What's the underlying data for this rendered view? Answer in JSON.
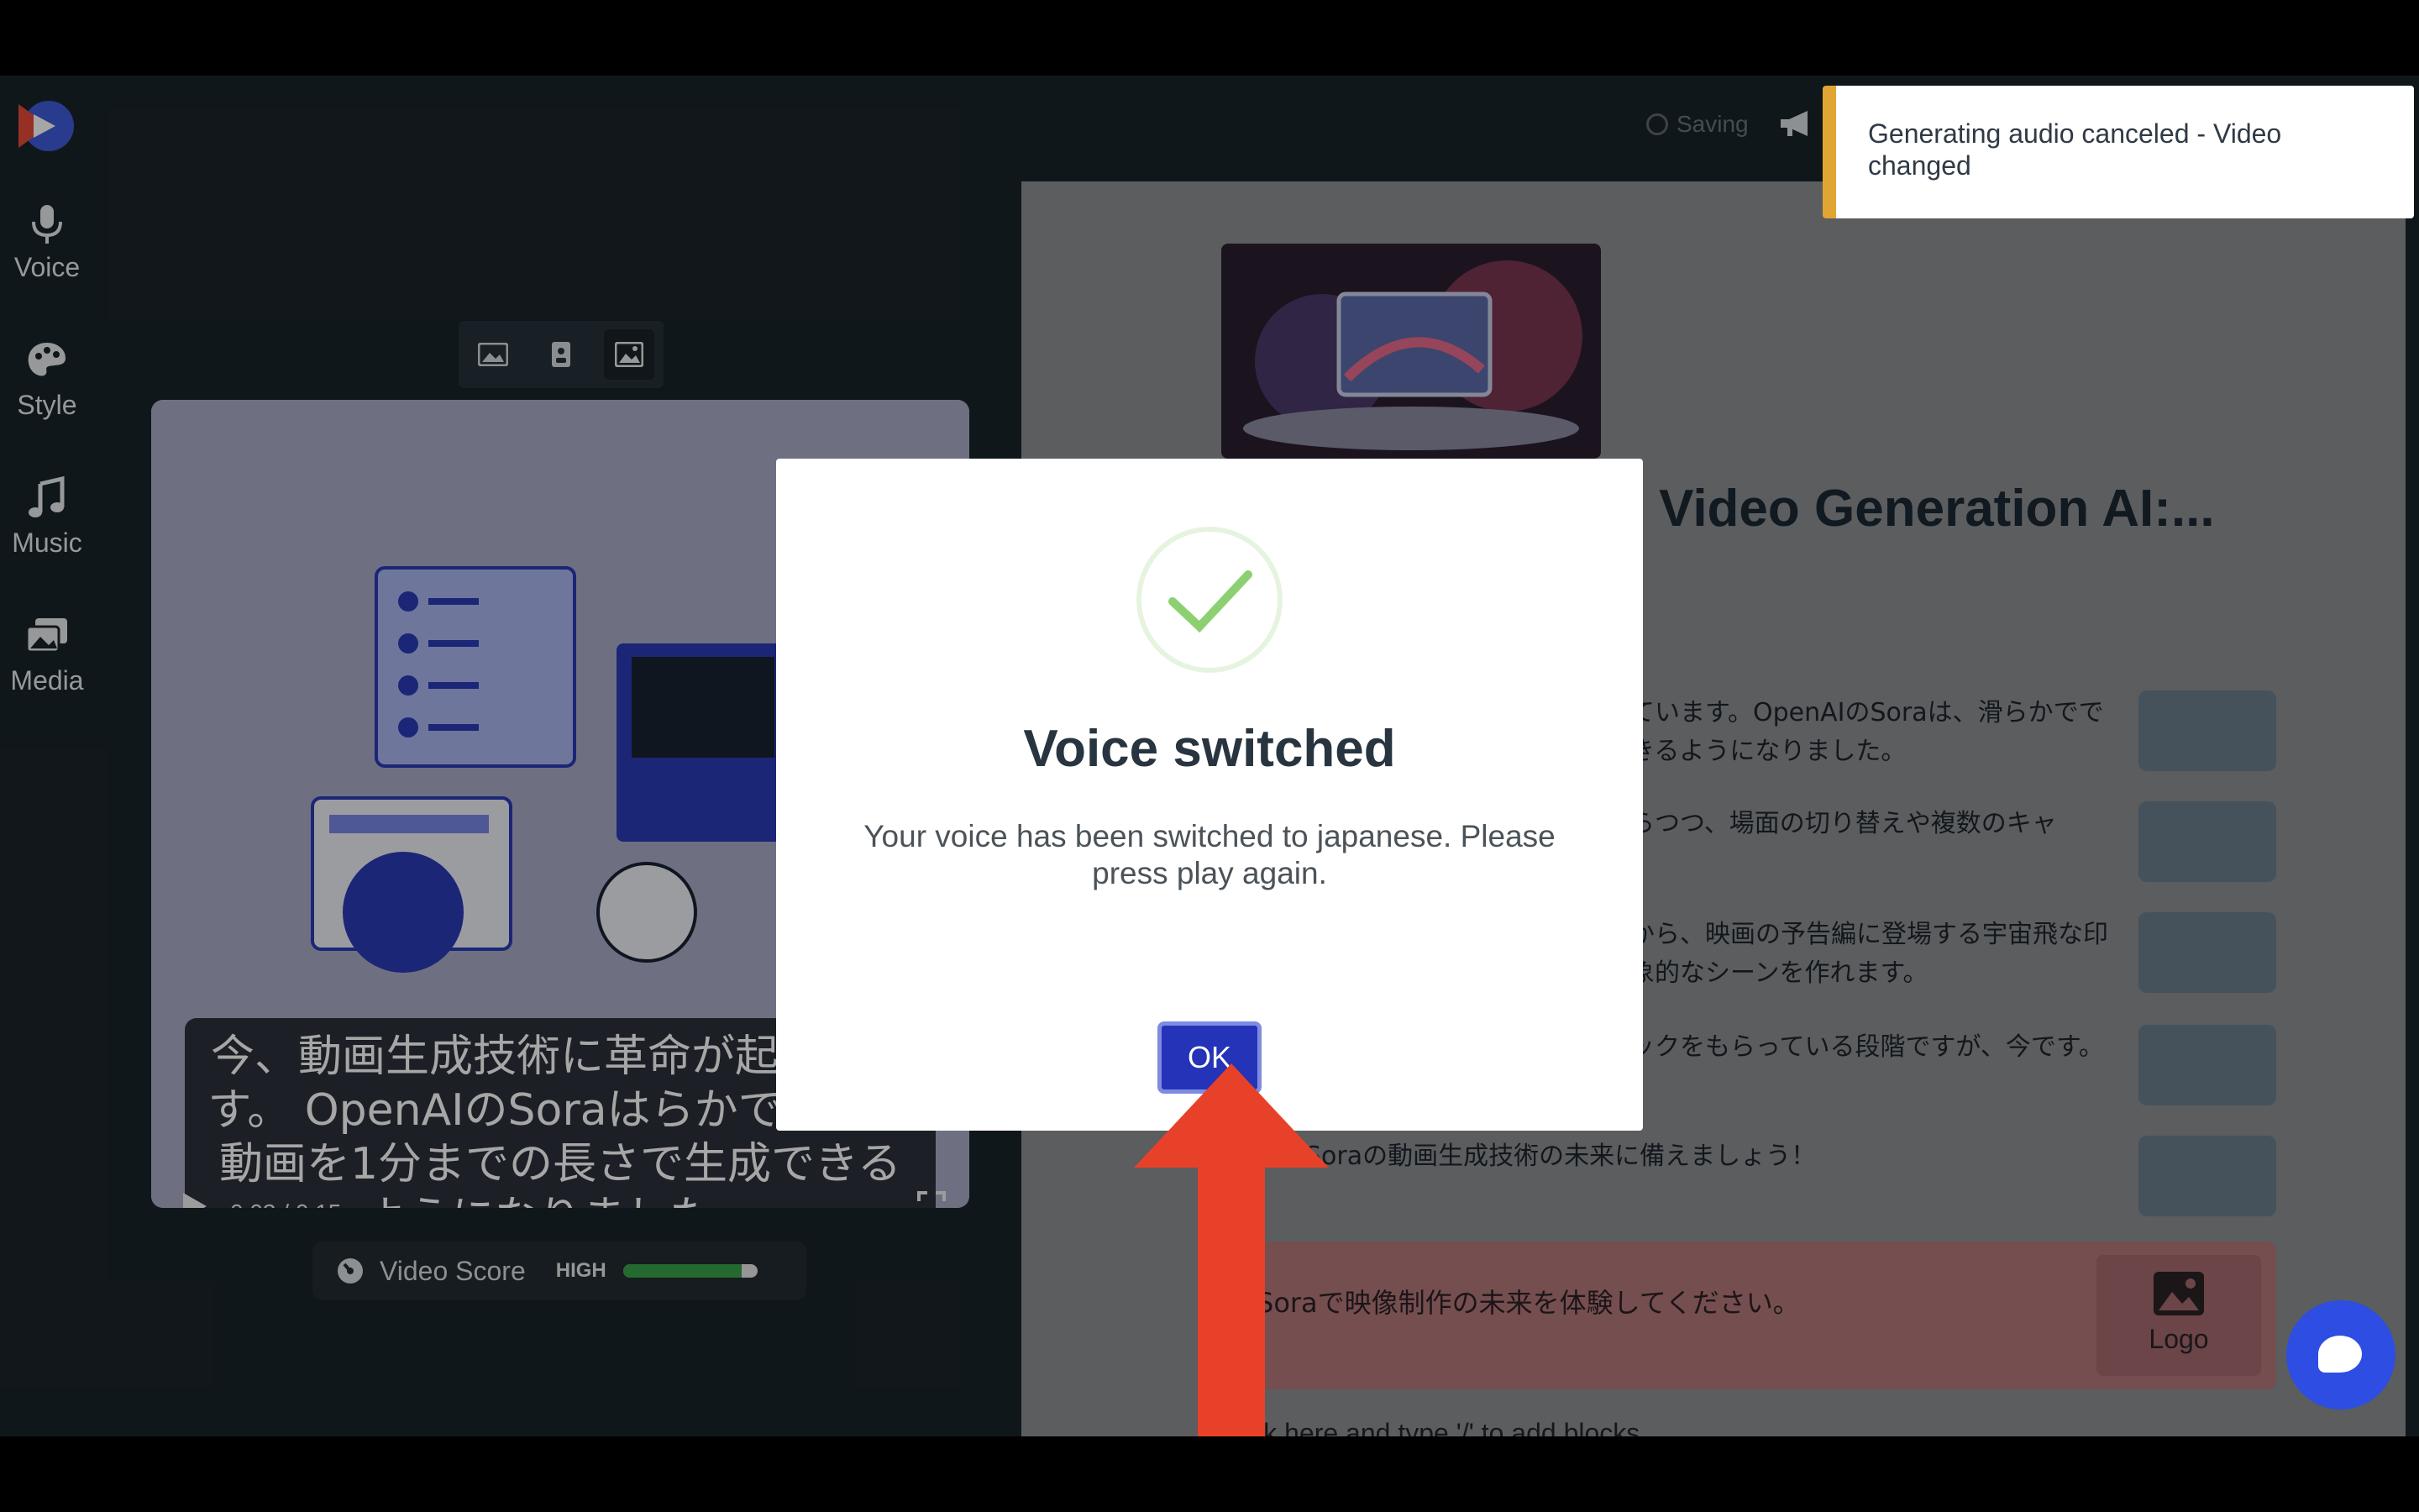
{
  "sidebar": {
    "items": [
      {
        "label": "Voice",
        "icon": "microphone-icon"
      },
      {
        "label": "Style",
        "icon": "palette-icon"
      },
      {
        "label": "Music",
        "icon": "music-note-icon"
      },
      {
        "label": "Media",
        "icon": "media-icon"
      }
    ]
  },
  "preview": {
    "subtitle": "今、動画生成技術に革命が起ています。 OpenAIのSoraはらかで詳細な動画を1分までの長さで生成できるようになりました。",
    "time": "0:03 / 0:15",
    "progress": 0.25
  },
  "score": {
    "label": "Video Score",
    "level": "HIGH",
    "value": 0.88
  },
  "status": {
    "saving": "Saving"
  },
  "toast": {
    "message": "Generating audio canceled - Video changed"
  },
  "editor": {
    "title": "n Video Generation AI:...",
    "rows": [
      "ています。OpenAIのSoraは、滑らかでできるようになりました。",
      "らつつ、場面の切り替えや複数のキャ",
      "から、映画の予告編に登場する宇宙飛な印象的なシーンを作れます。",
      "ックをもらっている段階ですが、今です。",
      "Soraの動画生成技術の未来に備えましょう！"
    ],
    "cta_text": "Soraで映像制作の未来を体験してください。",
    "logo_label": "Logo",
    "add_blocks": "lick here and type '/' to add blocks"
  },
  "modal": {
    "title": "Voice switched",
    "text": "Your voice has been switched to japanese. Please press play again.",
    "ok_label": "OK"
  },
  "colors": {
    "accent": "#2433b8",
    "toast_bar": "#e1a533",
    "check": "#8cd072",
    "arrow": "#e8412a"
  }
}
